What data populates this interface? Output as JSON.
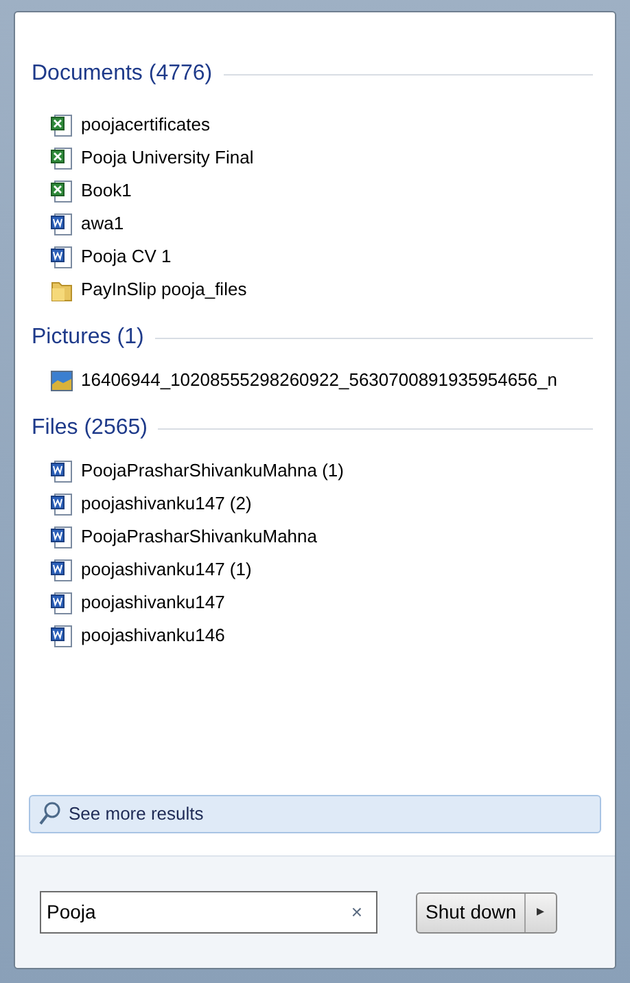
{
  "groups": [
    {
      "title": "Documents (4776)",
      "items": [
        {
          "kind": "excel",
          "label": "poojacertificates"
        },
        {
          "kind": "excel",
          "label": "Pooja University Final"
        },
        {
          "kind": "excel",
          "label": "Book1"
        },
        {
          "kind": "word",
          "label": "awa1"
        },
        {
          "kind": "word",
          "label": "Pooja CV 1"
        },
        {
          "kind": "folder",
          "label": "PayInSlip pooja_files"
        }
      ]
    },
    {
      "title": "Pictures (1)",
      "items": [
        {
          "kind": "picture",
          "label": "16406944_10208555298260922_5630700891935954656_n"
        }
      ]
    },
    {
      "title": "Files (2565)",
      "items": [
        {
          "kind": "word",
          "label": "PoojaPrasharShivankuMahna (1)"
        },
        {
          "kind": "word",
          "label": "poojashivanku147 (2)"
        },
        {
          "kind": "word",
          "label": "PoojaPrasharShivankuMahna"
        },
        {
          "kind": "word",
          "label": "poojashivanku147 (1)"
        },
        {
          "kind": "word",
          "label": "poojashivanku147"
        },
        {
          "kind": "word",
          "label": "poojashivanku146"
        }
      ]
    }
  ],
  "see_more": "See more results",
  "search": {
    "value": "Pooja",
    "clear": "×"
  },
  "shutdown": {
    "label": "Shut down",
    "arrow": "▸"
  }
}
